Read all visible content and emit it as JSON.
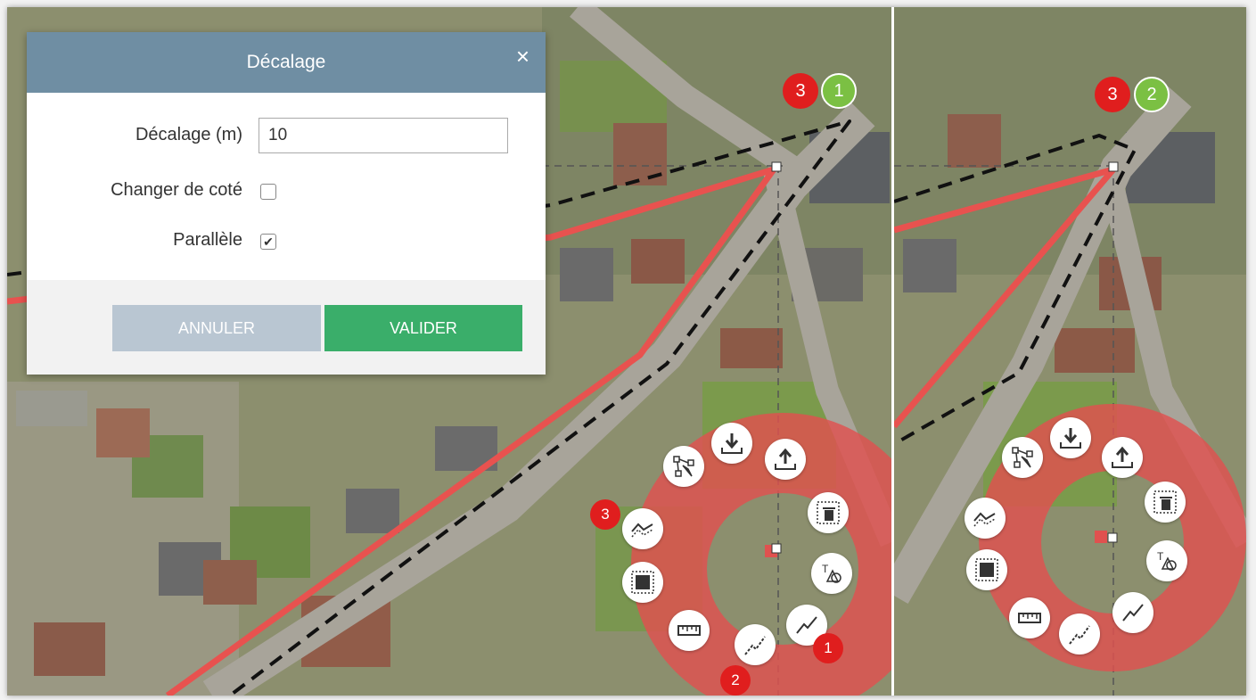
{
  "dialog": {
    "title": "Décalage",
    "close_glyph": "×",
    "offset_label": "Décalage (m)",
    "offset_value": "10",
    "change_side_label": "Changer de coté",
    "change_side_checked": false,
    "parallel_label": "Parallèle",
    "parallel_checked": true,
    "cancel_label": "ANNULER",
    "ok_label": "VALIDER"
  },
  "left_map": {
    "step_badges": [
      "3",
      "1"
    ],
    "menu_badges": {
      "simplify": "3",
      "draw_line": "1",
      "draw_line_dotted": "2"
    }
  },
  "right_map": {
    "step_badges": [
      "3",
      "2"
    ]
  },
  "tool_icons": [
    "graph-edit-icon",
    "download-tray-icon",
    "upload-tray-icon",
    "delete-selection-icon",
    "text-shape-icon",
    "draw-line-icon",
    "draw-line-dotted-icon",
    "measure-ruler-icon",
    "select-square-icon",
    "offset-line-icon"
  ],
  "colors": {
    "header": "#6f8ea3",
    "ok": "#3aae6a",
    "cancel": "#b9c6d2",
    "badge_red": "#e01e1e",
    "badge_green": "#7bc043",
    "route_red": "#e8524f",
    "menu_ring": "#e0514f"
  }
}
